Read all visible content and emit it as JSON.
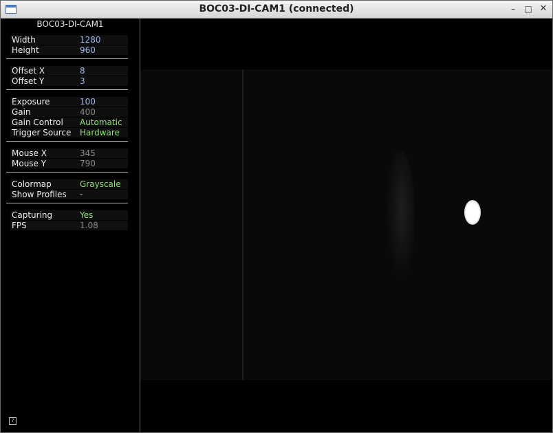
{
  "window": {
    "title": "BOC03-DI-CAM1 (connected)",
    "minimize_glyph": "–",
    "maximize_glyph": "□",
    "close_glyph": "✕"
  },
  "sidebar": {
    "camera_name": "BOC03-DI-CAM1",
    "groups": [
      {
        "rows": [
          {
            "label": "Width",
            "value": "1280",
            "value_color": "#9fb8ee"
          },
          {
            "label": "Height",
            "value": "960",
            "value_color": "#9fb8ee"
          }
        ]
      },
      {
        "rows": [
          {
            "label": "Offset X",
            "value": "8",
            "value_color": "#9fb8ee"
          },
          {
            "label": "Offset Y",
            "value": "3",
            "value_color": "#9fb8ee"
          }
        ]
      },
      {
        "rows": [
          {
            "label": "Exposure",
            "value": "100",
            "value_color": "#9fb8ee"
          },
          {
            "label": "Gain",
            "value": "400",
            "value_color": "#8a8a8a"
          },
          {
            "label": "Gain Control",
            "value": "Automatic",
            "value_color": "#8fdc7a"
          },
          {
            "label": "Trigger Source",
            "value": "Hardware",
            "value_color": "#8fdc7a"
          }
        ]
      },
      {
        "rows": [
          {
            "label": "Mouse X",
            "value": "345",
            "value_color": "#8a8a8a"
          },
          {
            "label": "Mouse Y",
            "value": "790",
            "value_color": "#8a8a8a"
          }
        ]
      },
      {
        "rows": [
          {
            "label": "Colormap",
            "value": "Grayscale",
            "value_color": "#8fdc7a"
          },
          {
            "label": "Show Profiles",
            "value": " -",
            "value_color": "#cfcfcf"
          }
        ]
      },
      {
        "rows": [
          {
            "label": "Capturing",
            "value": "Yes",
            "value_color": "#8fdc7a"
          },
          {
            "label": "FPS",
            "value": "1.08",
            "value_color": "#8a8a8a"
          }
        ]
      }
    ],
    "help_glyph": "?"
  },
  "colors": {
    "background": "#000000",
    "label_text": "#ececec",
    "separator": "#bdbdbd"
  }
}
